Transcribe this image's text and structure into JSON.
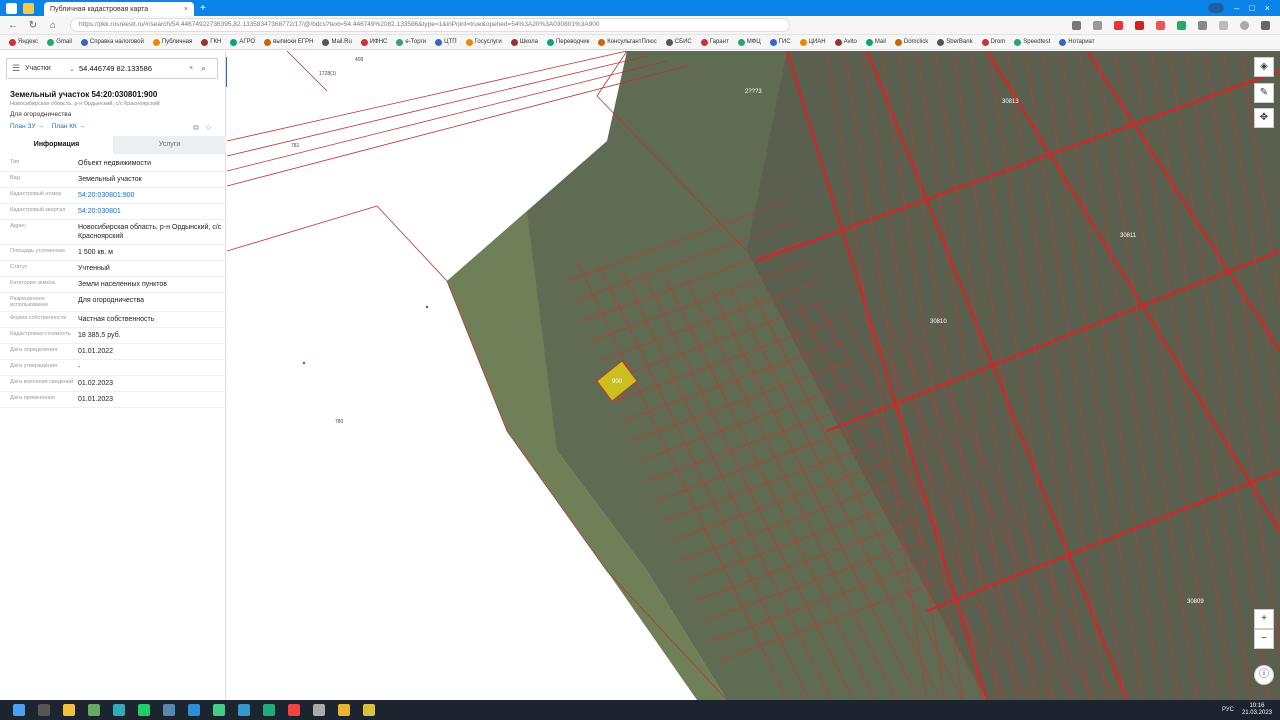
{
  "browser": {
    "tab_title": "Публичная кадастровая карта",
    "url": "https://pkk.rosreestr.ru/#/search/54.44674922736395,82.13358347368772/17/@/bdcs?text=54.446749%2082.133586&type=1&inPoint=true&opened=54%3A20%3A030801%3A900",
    "profile_label": "",
    "bookmarks": [
      "Яндекс",
      "Gmail",
      "Справка налоговой",
      "Публичная",
      "ГКН",
      "АГРО",
      "выписки ЕГРН",
      "Mail.Ru",
      "ИФНС",
      "e-Торги",
      "ЦТП",
      "Госуслуги",
      "Школа",
      "Переводчик",
      "КонсультантПлюс",
      "СБИС",
      "Гарант",
      "МФЦ",
      "ГИС",
      "ЦИАН",
      "Avito",
      "Mail",
      "Domclick",
      "SberBank",
      "Drom",
      "Speedtest",
      "Нотариат"
    ]
  },
  "panel": {
    "search_category": "Участки",
    "search_value": "54.446749 82.133586",
    "title": "Земельный участок 54:20:030801:900",
    "address_line": "Новосибирская область, р-н Ордынский, с/с Красноярский",
    "type_line": "Для огородничества",
    "link1": "План ЗУ →",
    "link2": "План КК →",
    "tab_info": "Информация",
    "tab_services": "Услуги",
    "rows": [
      {
        "k": "Тип",
        "v": "Объект недвижимости"
      },
      {
        "k": "Вид",
        "v": "Земельный участок"
      },
      {
        "k": "Кадастровый номер",
        "v": "54:20:030801:900"
      },
      {
        "k": "Кадастровый квартал",
        "v": "54:20:030801"
      },
      {
        "k": "Адрес",
        "v": "Новосибирская область, р-н Ордынский, с/с Красноярский"
      },
      {
        "k": "Площадь уточненная",
        "v": "1 500 кв. м"
      },
      {
        "k": "Статус",
        "v": "Учтенный"
      },
      {
        "k": "Категория земель",
        "v": "Земли населенных пунктов"
      },
      {
        "k": "Разрешенное использование",
        "v": "Для огородничества"
      },
      {
        "k": "Форма собственности",
        "v": "Частная собственность"
      },
      {
        "k": "Кадастровая стоимость",
        "v": "18 385,5 руб."
      },
      {
        "k": "Дата определения",
        "v": "01.01.2022"
      },
      {
        "k": "Дата утверждения",
        "v": "-"
      },
      {
        "k": "Дата внесения сведений",
        "v": "01.02.2023"
      },
      {
        "k": "Дата применения",
        "v": "01.01.2023"
      }
    ]
  },
  "map": {
    "labels_left": [
      "409",
      "1728(1)",
      "781",
      "780"
    ],
    "quarter_labels": [
      "2???3",
      "30813",
      "30811",
      "30810",
      "30809"
    ],
    "parcel_label": "900",
    "accent_parcel_color": "#c9c020"
  },
  "taskbar": {
    "time": "10:16",
    "date": "21.03.2023",
    "lang": "РУС"
  }
}
